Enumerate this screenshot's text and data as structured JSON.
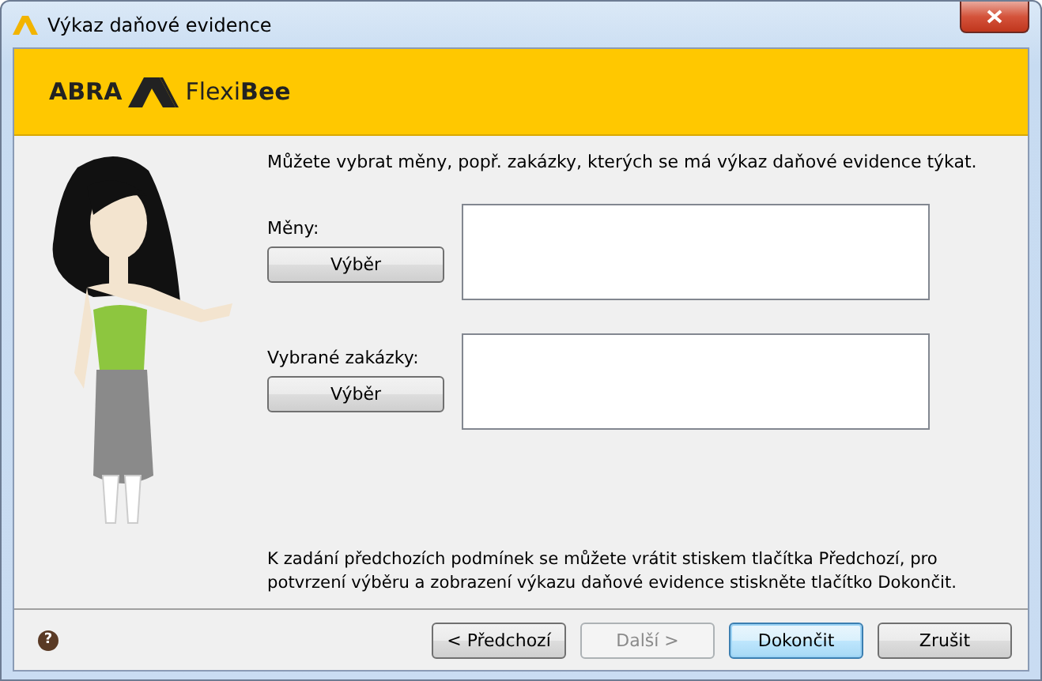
{
  "window": {
    "title": "Výkaz daňové evidence"
  },
  "logo": {
    "left": "ABRA",
    "right": "Flexi**Bee**"
  },
  "intro": "Můžete vybrat měny, popř. zakázky, kterých se má výkaz daňové evidence týkat.",
  "sections": [
    {
      "label": "Měny:",
      "button": "Výběr"
    },
    {
      "label": "Vybrané zakázky:",
      "button": "Výběr"
    }
  ],
  "footer_text": "K zadání předchozích podmínek se můžete vrátit stiskem tlačítka Předchozí, pro potvrzení výběru a zobrazení výkazu daňové evidence stiskněte tlačítko Dokončit.",
  "help": "?",
  "buttons": [
    {
      "label": "< Předchozí",
      "disabled": false,
      "focused": false
    },
    {
      "label": "Další >",
      "disabled": true,
      "focused": false
    },
    {
      "label": "Dokončit",
      "disabled": false,
      "focused": true
    },
    {
      "label": "Zrušit",
      "disabled": false,
      "focused": false
    }
  ]
}
